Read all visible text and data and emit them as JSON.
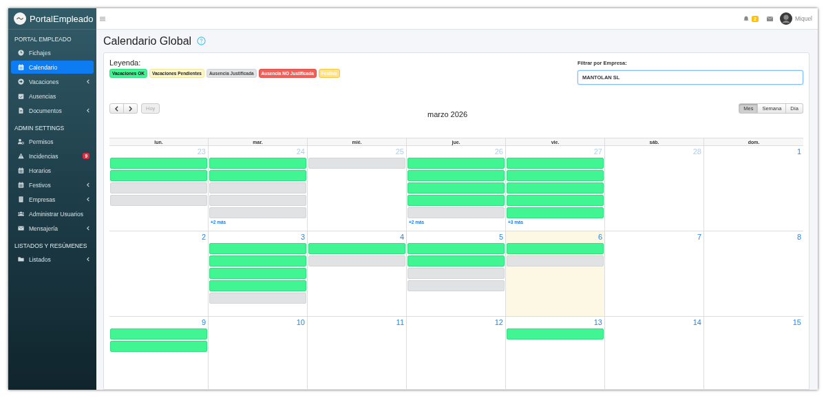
{
  "brand": {
    "name": "PortalEmpleado"
  },
  "topbar": {
    "notifications": "2",
    "user": "Miquel"
  },
  "sidebar": {
    "sections": [
      {
        "title": "PORTAL EMPLEADO",
        "items": [
          {
            "kind": "clock",
            "label": "Fichajes",
            "selected": false,
            "submenu": false
          },
          {
            "kind": "calendar",
            "label": "Calendario",
            "selected": true,
            "submenu": false
          },
          {
            "kind": "arrow",
            "label": "Vacaciones",
            "selected": false,
            "submenu": true
          },
          {
            "kind": "calendar-check",
            "label": "Ausencias",
            "selected": false,
            "submenu": false
          },
          {
            "kind": "file",
            "label": "Documentos",
            "selected": false,
            "submenu": true
          }
        ]
      },
      {
        "title": "ADMIN SETTINGS",
        "items": [
          {
            "kind": "user-gear",
            "label": "Permisos",
            "selected": false,
            "submenu": false
          },
          {
            "kind": "warning",
            "label": "Incidencias",
            "selected": false,
            "submenu": false,
            "badge": "9"
          },
          {
            "kind": "calendar",
            "label": "Horarios",
            "selected": false,
            "submenu": false
          },
          {
            "kind": "calendar",
            "label": "Festivos",
            "selected": false,
            "submenu": true
          },
          {
            "kind": "building",
            "label": "Empresas",
            "selected": false,
            "submenu": true
          },
          {
            "kind": "users",
            "label": "Administrar Usuarios",
            "selected": false,
            "submenu": false
          },
          {
            "kind": "envelope",
            "label": "Mensajería",
            "selected": false,
            "submenu": true
          }
        ]
      },
      {
        "title": "LISTADOS Y RESÚMENES",
        "items": [
          {
            "kind": "folder",
            "label": "Listados",
            "selected": false,
            "submenu": true
          }
        ]
      }
    ]
  },
  "page": {
    "title": "Calendario Global"
  },
  "legend": {
    "title": "Leyenda:",
    "items": [
      {
        "kind": "ok",
        "label": "Vacaciones OK"
      },
      {
        "kind": "pending",
        "label": "Vacaciones Pendientes"
      },
      {
        "kind": "justified",
        "label": "Ausencia Justificada"
      },
      {
        "kind": "unjustified",
        "label": "Ausencia NO Justificada"
      },
      {
        "kind": "holiday",
        "label": "Festivo"
      }
    ]
  },
  "filter": {
    "label": "Filtrar por Empresa:",
    "value": "MANTOLAN SL"
  },
  "calendar": {
    "title": "marzo 2026",
    "today_button": "Hoy",
    "views": [
      {
        "label": "Mes",
        "selected": true
      },
      {
        "label": "Semana",
        "selected": false
      },
      {
        "label": "Día",
        "selected": false
      }
    ],
    "weekdays": [
      "lun.",
      "mar.",
      "mié.",
      "jue.",
      "vie.",
      "sáb.",
      "dom."
    ],
    "weeks": [
      {
        "days": [
          {
            "day": "23",
            "other_month": true,
            "today": false,
            "events": [
              {
                "kind": "ok"
              },
              {
                "kind": "ok"
              },
              {
                "kind": "justified"
              },
              {
                "kind": "justified"
              }
            ]
          },
          {
            "day": "24",
            "other_month": true,
            "today": false,
            "events": [
              {
                "kind": "ok"
              },
              {
                "kind": "ok"
              },
              {
                "kind": "justified"
              },
              {
                "kind": "justified"
              },
              {
                "kind": "justified"
              }
            ],
            "more": "+2 más"
          },
          {
            "day": "25",
            "other_month": true,
            "today": false,
            "events": [
              {
                "kind": "justified"
              }
            ]
          },
          {
            "day": "26",
            "other_month": true,
            "today": false,
            "events": [
              {
                "kind": "ok"
              },
              {
                "kind": "ok"
              },
              {
                "kind": "ok"
              },
              {
                "kind": "ok"
              },
              {
                "kind": "justified"
              }
            ],
            "more": "+2 más"
          },
          {
            "day": "27",
            "other_month": true,
            "today": false,
            "events": [
              {
                "kind": "ok"
              },
              {
                "kind": "ok"
              },
              {
                "kind": "ok"
              },
              {
                "kind": "ok"
              },
              {
                "kind": "ok"
              }
            ],
            "more": "+3 más"
          },
          {
            "day": "28",
            "other_month": true,
            "today": false
          },
          {
            "day": "1",
            "other_month": false,
            "today": false
          }
        ]
      },
      {
        "days": [
          {
            "day": "2",
            "other_month": false,
            "today": false
          },
          {
            "day": "3",
            "other_month": false,
            "today": false,
            "events": [
              {
                "kind": "ok"
              },
              {
                "kind": "ok"
              },
              {
                "kind": "ok"
              },
              {
                "kind": "ok"
              },
              {
                "kind": "justified"
              }
            ]
          },
          {
            "day": "4",
            "other_month": false,
            "today": false,
            "events": [
              {
                "kind": "ok"
              },
              {
                "kind": "justified"
              }
            ]
          },
          {
            "day": "5",
            "other_month": false,
            "today": false,
            "events": [
              {
                "kind": "ok"
              },
              {
                "kind": "ok"
              },
              {
                "kind": "justified"
              },
              {
                "kind": "justified"
              }
            ]
          },
          {
            "day": "6",
            "other_month": false,
            "today": true,
            "events": [
              {
                "kind": "ok"
              },
              {
                "kind": "justified"
              }
            ]
          },
          {
            "day": "7",
            "other_month": false,
            "today": false
          },
          {
            "day": "8",
            "other_month": false,
            "today": false
          }
        ]
      },
      {
        "days": [
          {
            "day": "9",
            "other_month": false,
            "today": false,
            "events": [
              {
                "kind": "ok"
              },
              {
                "kind": "ok"
              }
            ]
          },
          {
            "day": "10",
            "other_month": false,
            "today": false
          },
          {
            "day": "11",
            "other_month": false,
            "today": false
          },
          {
            "day": "12",
            "other_month": false,
            "today": false
          },
          {
            "day": "13",
            "other_month": false,
            "today": false,
            "events": [
              {
                "kind": "ok"
              }
            ]
          },
          {
            "day": "14",
            "other_month": false,
            "today": false
          },
          {
            "day": "15",
            "other_month": false,
            "today": false
          }
        ]
      }
    ]
  }
}
